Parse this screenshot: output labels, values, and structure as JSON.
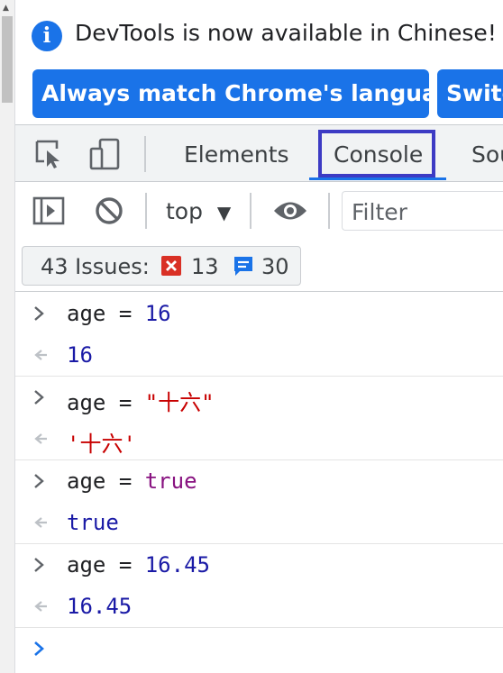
{
  "banner": {
    "message": "DevTools is now available in Chinese!",
    "button_match": "Always match Chrome's language",
    "button_switch": "Switch DevTools to Chinese"
  },
  "tabs": {
    "elements": "Elements",
    "console": "Console",
    "sources": "Sources"
  },
  "toolbar": {
    "context": "top",
    "context_arrow": "▼",
    "filter_placeholder": "Filter"
  },
  "issues": {
    "label": "43 Issues:",
    "errors": "13",
    "info": "30"
  },
  "console": {
    "entries": [
      {
        "var": "age",
        "op": "=",
        "value": "16",
        "result": "16"
      },
      {
        "var": "age",
        "op": "=",
        "value": "\"十六\"",
        "result": "'十六'"
      },
      {
        "var": "age",
        "op": "=",
        "value": "true",
        "result": "true"
      },
      {
        "var": "age",
        "op": "=",
        "value": "16.45",
        "result": "16.45"
      }
    ]
  },
  "colors": {
    "accent": "#1a73e8",
    "highlight_box": "#3d3bc4",
    "number": "#1a1aa6",
    "string": "#c80000",
    "boolean": "#881280",
    "error": "#d93025"
  }
}
